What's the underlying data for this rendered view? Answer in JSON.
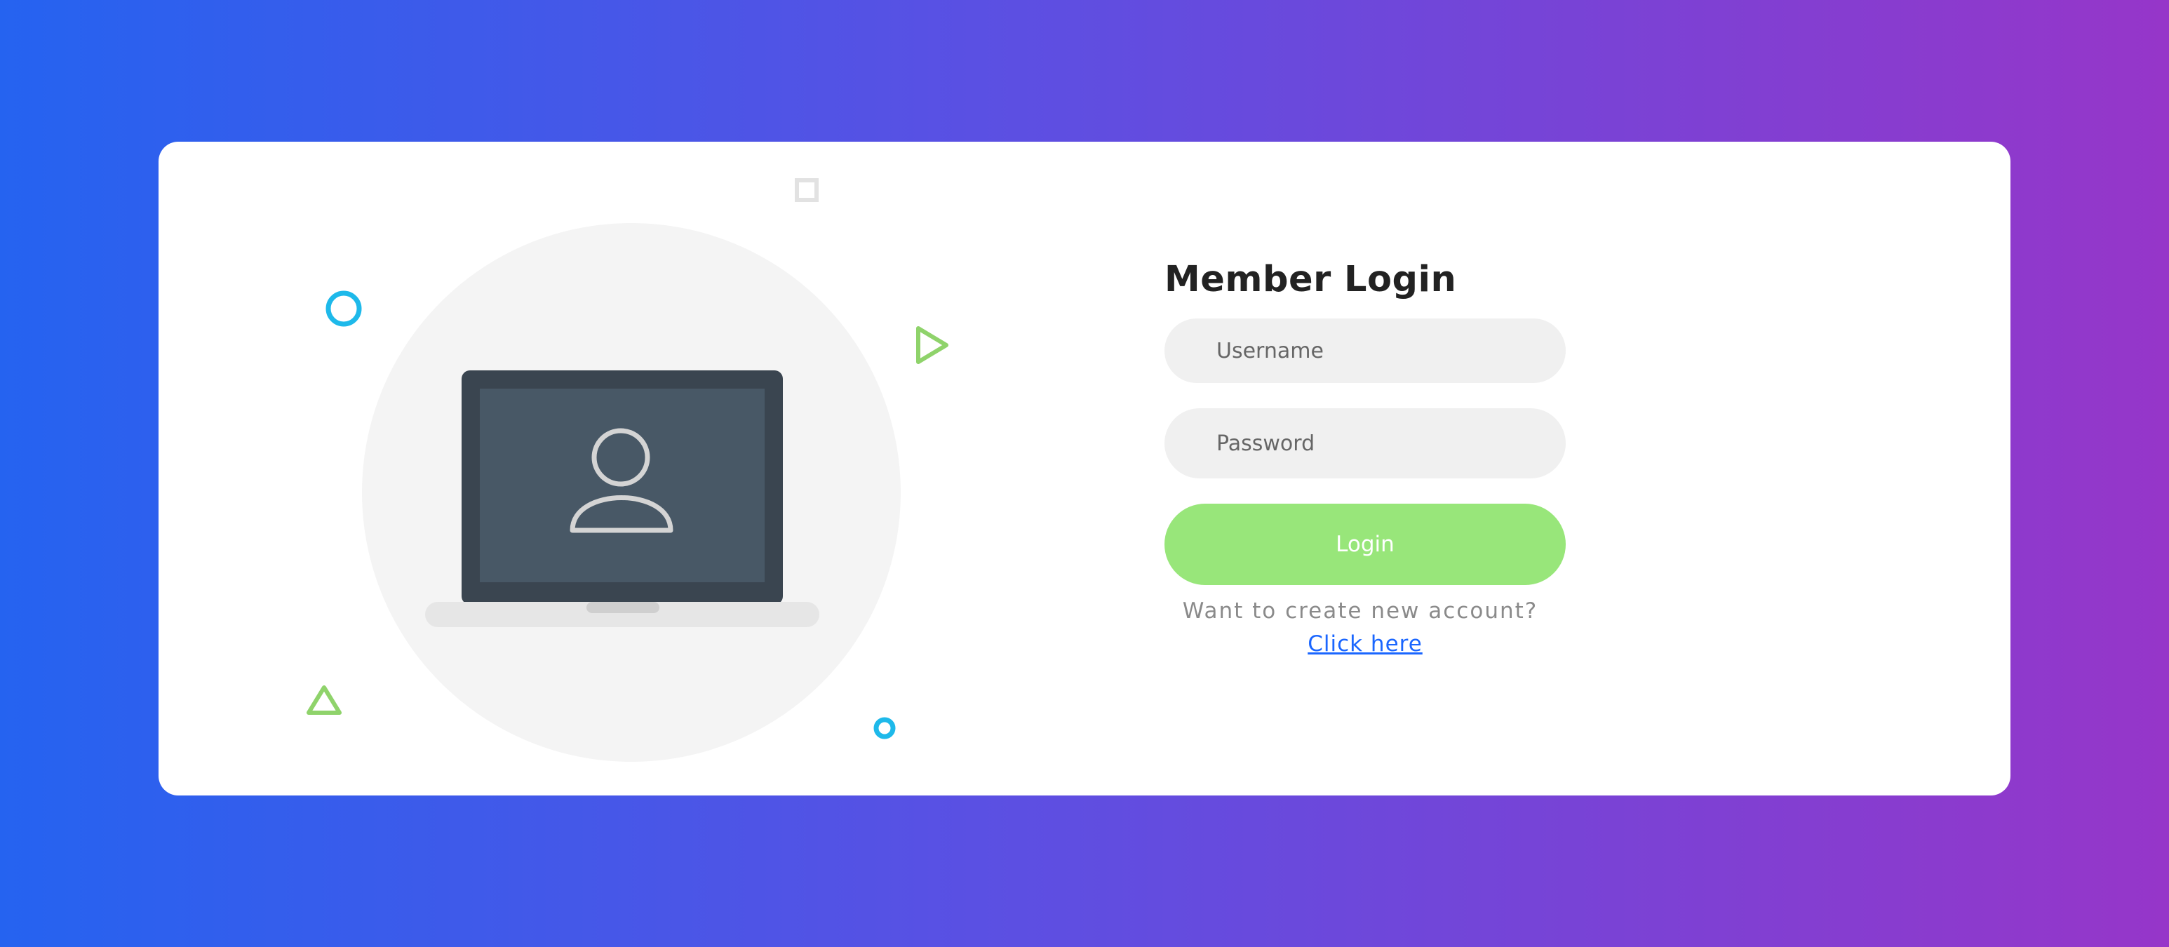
{
  "page": {
    "background_gradient": [
      "#2563f0",
      "#5a50e3",
      "#9636c9"
    ],
    "card_background": "#ffffff"
  },
  "illustration": {
    "main_icon": "laptop-user-icon",
    "decorations": [
      "circle-outline-icon",
      "square-outline-icon",
      "triangle-right-outline-icon",
      "triangle-outline-icon",
      "small-circle-outline-icon"
    ],
    "accent_blue": "#1eb9ea",
    "accent_green": "#8fd36b"
  },
  "login": {
    "title": "Member Login",
    "username_placeholder": "Username",
    "password_placeholder": "Password",
    "button_label": "Login",
    "button_color": "#98e67a",
    "signup_prompt": "Want to create new account?",
    "signup_link": "Click here",
    "link_color": "#1a66ff"
  }
}
